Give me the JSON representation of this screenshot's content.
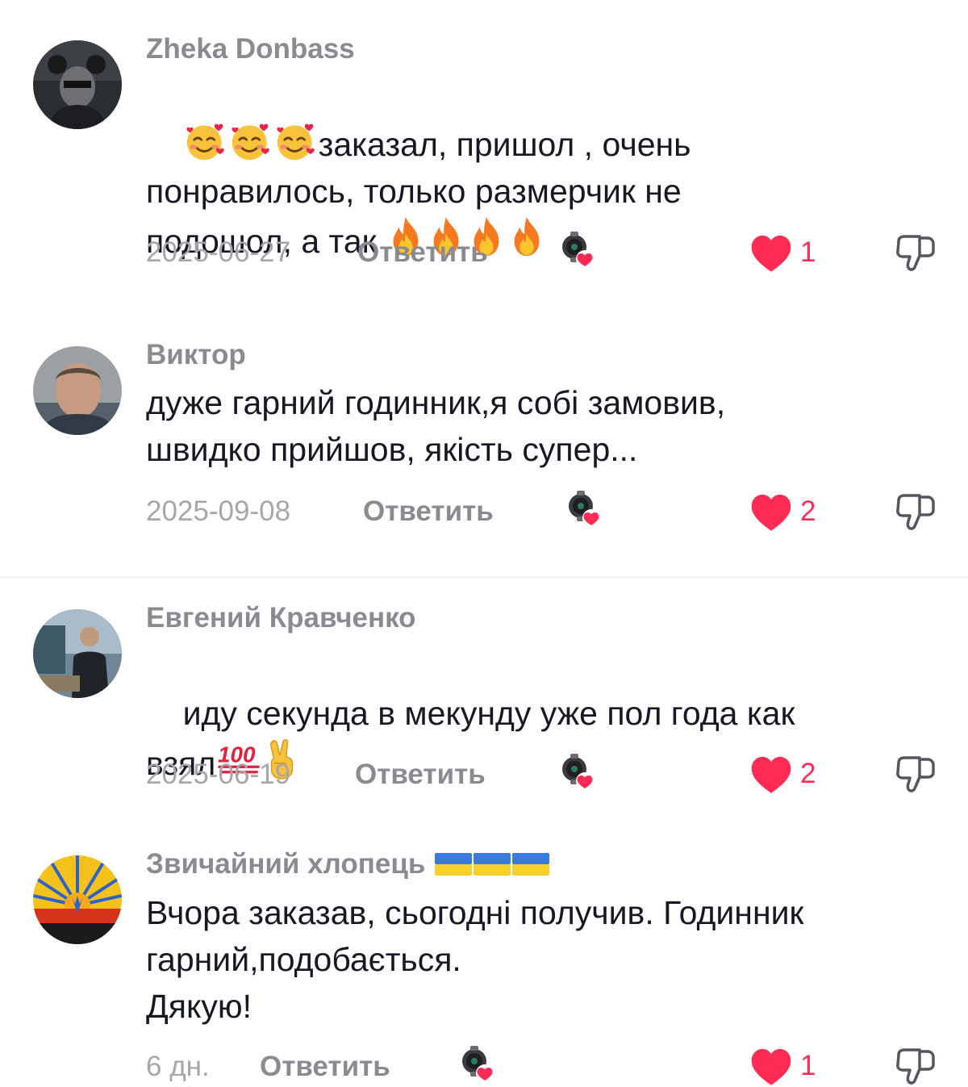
{
  "comments": [
    {
      "author": "Zheka Donbass",
      "text_line1": "заказал, пришол , очень",
      "text_line2": "понравилось, только размерчик не",
      "text_line3": "подошол, а так ",
      "date": "2025-06-27",
      "reply_label": "Ответить",
      "likes": "1"
    },
    {
      "author": "Виктор",
      "text": "дуже гарний годинник,я собі замовив,\nшвидко прийшов, якість супер...",
      "date": "2025-09-08",
      "reply_label": "Ответить",
      "likes": "2"
    },
    {
      "author": "Евгений Кравченко",
      "text_line1": "иду секунда в мекунду уже пол года как",
      "text_line2": "взял",
      "date": "2025-06-19",
      "reply_label": "Ответить",
      "likes": "2"
    },
    {
      "author": "Звичайний хлопець ",
      "text": "Вчора заказав, сьогодні получив. Годинник\nгарний,подобається.\nДякую!",
      "date": "6 дн.",
      "reply_label": "Ответить",
      "likes": "1"
    }
  ],
  "colors": {
    "like_red": "#fe2c55",
    "author_gray": "#8a8b91",
    "date_gray": "#a6a7ab",
    "text_dark": "#161823"
  },
  "icons": [
    "heart-icon",
    "dislike-icon",
    "creator-like-icon",
    "smiling-face-with-hearts-emoji",
    "fire-emoji",
    "hundred-points-emoji",
    "victory-hand-emoji",
    "ukraine-flag-emoji"
  ]
}
